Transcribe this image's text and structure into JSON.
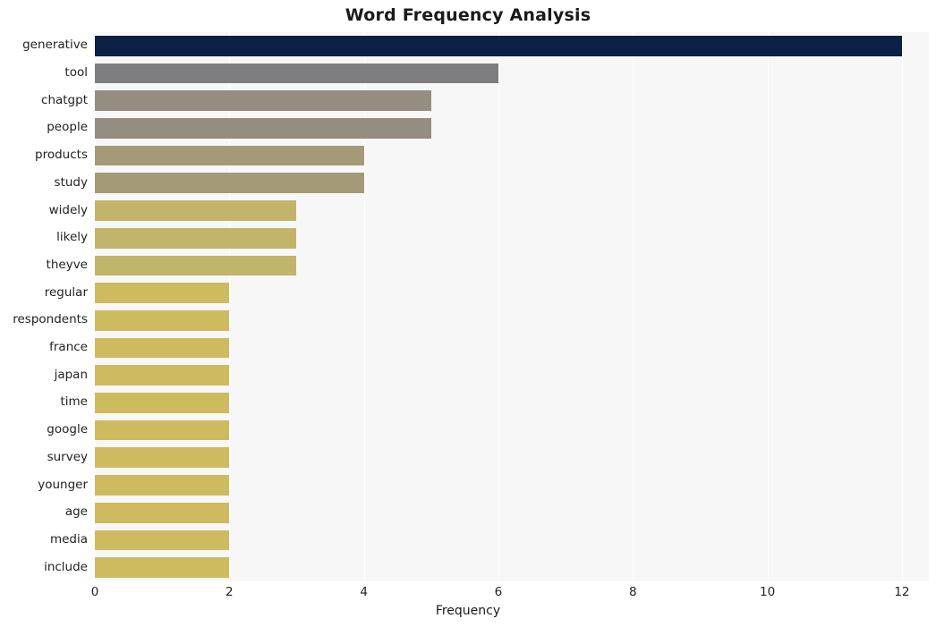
{
  "chart_data": {
    "type": "bar",
    "orientation": "horizontal",
    "title": "Word Frequency Analysis",
    "xlabel": "Frequency",
    "ylabel": "",
    "xlim": [
      0,
      12.4
    ],
    "xticks": [
      0,
      2,
      4,
      6,
      8,
      10,
      12
    ],
    "xtick_labels": [
      "0",
      "2",
      "4",
      "6",
      "8",
      "10",
      "12"
    ],
    "grid": "vertical",
    "legend": null,
    "categories": [
      "generative",
      "tool",
      "chatgpt",
      "people",
      "products",
      "study",
      "widely",
      "likely",
      "theyve",
      "regular",
      "respondents",
      "france",
      "japan",
      "time",
      "google",
      "survey",
      "younger",
      "age",
      "media",
      "include"
    ],
    "values": [
      12,
      6,
      5,
      5,
      4,
      4,
      3,
      3,
      3,
      2,
      2,
      2,
      2,
      2,
      2,
      2,
      2,
      2,
      2,
      2
    ],
    "bar_colors": [
      "#0b2045",
      "#7e7e80",
      "#948d80",
      "#948d80",
      "#a49a78",
      "#a49a78",
      "#c3b46c",
      "#c3b46c",
      "#c3b46c",
      "#ceba5f",
      "#ceba5f",
      "#ceba5f",
      "#ceba5f",
      "#ceba5f",
      "#ceba5f",
      "#ceba5f",
      "#ceba5f",
      "#ceba5f",
      "#ceba5f",
      "#ceba5f"
    ],
    "plot_background": "#f7f7f7",
    "figure_background": "#ffffff"
  }
}
